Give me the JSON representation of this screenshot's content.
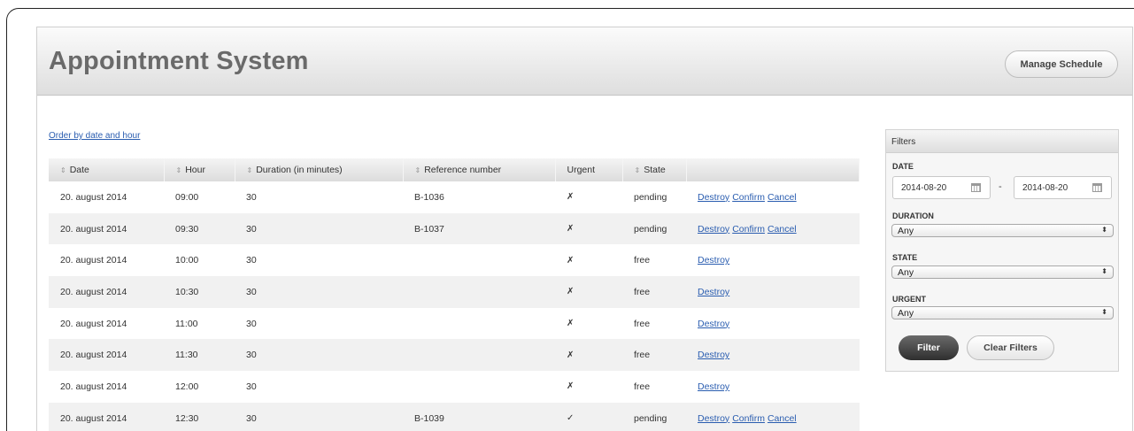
{
  "header": {
    "title": "Appointment System",
    "manage_label": "Manage Schedule"
  },
  "order_link": "Order by date and hour",
  "table": {
    "columns": [
      "Date",
      "Hour",
      "Duration (in minutes)",
      "Reference number",
      "Urgent",
      "State",
      ""
    ],
    "rows": [
      {
        "date": "20. august 2014",
        "hour": "09:00",
        "duration": "30",
        "ref": "B-1036",
        "urgent": "✗",
        "state": "pending",
        "actions": [
          "Destroy",
          "Confirm",
          "Cancel"
        ]
      },
      {
        "date": "20. august 2014",
        "hour": "09:30",
        "duration": "30",
        "ref": "B-1037",
        "urgent": "✗",
        "state": "pending",
        "actions": [
          "Destroy",
          "Confirm",
          "Cancel"
        ]
      },
      {
        "date": "20. august 2014",
        "hour": "10:00",
        "duration": "30",
        "ref": "",
        "urgent": "✗",
        "state": "free",
        "actions": [
          "Destroy"
        ]
      },
      {
        "date": "20. august 2014",
        "hour": "10:30",
        "duration": "30",
        "ref": "",
        "urgent": "✗",
        "state": "free",
        "actions": [
          "Destroy"
        ]
      },
      {
        "date": "20. august 2014",
        "hour": "11:00",
        "duration": "30",
        "ref": "",
        "urgent": "✗",
        "state": "free",
        "actions": [
          "Destroy"
        ]
      },
      {
        "date": "20. august 2014",
        "hour": "11:30",
        "duration": "30",
        "ref": "",
        "urgent": "✗",
        "state": "free",
        "actions": [
          "Destroy"
        ]
      },
      {
        "date": "20. august 2014",
        "hour": "12:00",
        "duration": "30",
        "ref": "",
        "urgent": "✗",
        "state": "free",
        "actions": [
          "Destroy"
        ]
      },
      {
        "date": "20. august 2014",
        "hour": "12:30",
        "duration": "30",
        "ref": "B-1039",
        "urgent": "✓",
        "state": "pending",
        "actions": [
          "Destroy",
          "Confirm",
          "Cancel"
        ]
      }
    ]
  },
  "filters": {
    "title": "Filters",
    "date_label": "DATE",
    "date_from": "2014-08-20",
    "date_separator": "-",
    "date_to": "2014-08-20",
    "duration_label": "DURATION",
    "duration_value": "Any",
    "state_label": "STATE",
    "state_value": "Any",
    "urgent_label": "URGENT",
    "urgent_value": "Any",
    "filter_label": "Filter",
    "clear_label": "Clear Filters"
  },
  "icons": {
    "sort": "sort-icon",
    "calendar": "calendar-icon",
    "select_arrow": "select-arrow-icon"
  }
}
